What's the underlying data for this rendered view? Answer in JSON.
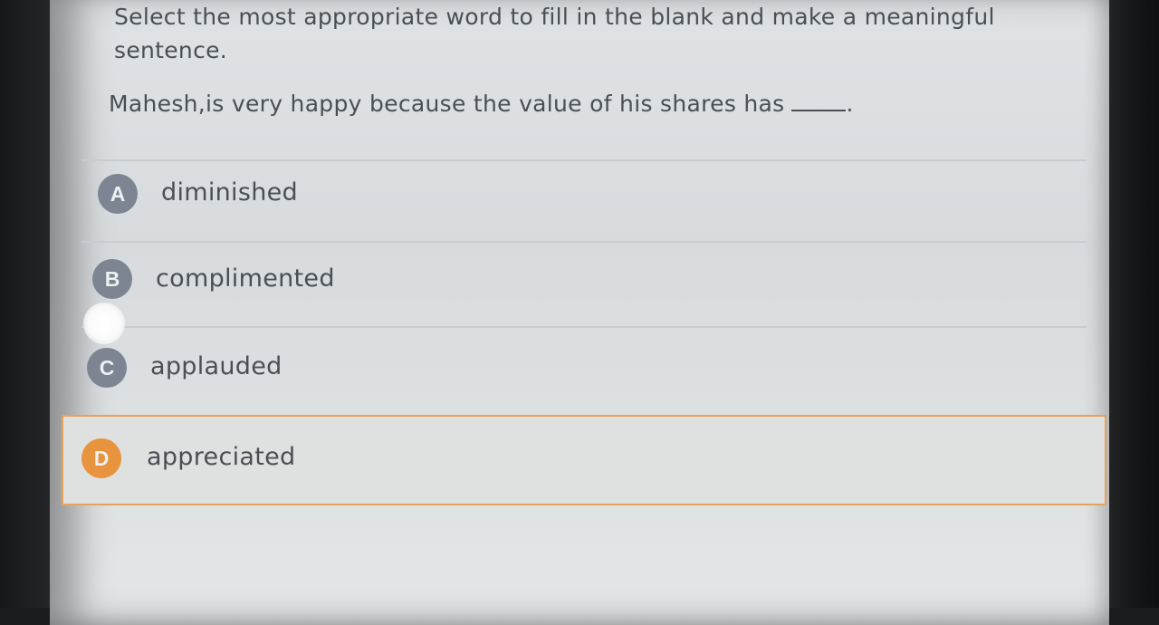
{
  "question": {
    "instruction": "Select the most appropriate word to fill in the blank and make a meaningful sentence.",
    "sentence": "Mahesh,is very happy because the value of his shares has",
    "sentence_end": "."
  },
  "options": [
    {
      "letter": "A",
      "text": "diminished"
    },
    {
      "letter": "B",
      "text": "complimented"
    },
    {
      "letter": "C",
      "text": "applauded"
    },
    {
      "letter": "D",
      "text": "appreciated"
    }
  ],
  "selected_option": "D",
  "colors": {
    "badge_default": "#7c8591",
    "badge_selected": "#e8933d",
    "selected_border": "#e6a25a"
  }
}
